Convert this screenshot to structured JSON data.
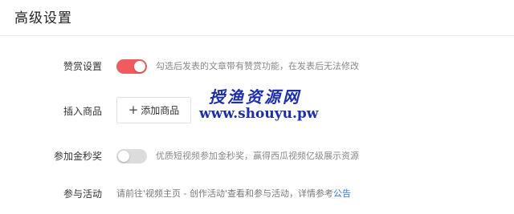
{
  "page": {
    "title": "高级设置"
  },
  "settings": {
    "appreciation": {
      "label": "赞赏设置",
      "toggle_on": true,
      "hint": "勾选后发表的文章带有赞赏功能，在发表后无法修改"
    },
    "insert_product": {
      "label": "插入商品",
      "button_label": "添加商品",
      "button_icon": "plus-icon"
    },
    "golden_second": {
      "label": "参加金秒奖",
      "toggle_on": false,
      "hint": "优质短视频参加金秒奖，赢得西瓜视频亿级展示资源"
    },
    "activity": {
      "label": "参与活动",
      "text": "请前往'视频主页 - 创作活动'查看和参与活动，详情参考",
      "link_label": "公告"
    }
  },
  "watermark": {
    "text_cn": "授渔资源网",
    "url": "www.shouyu.pw"
  },
  "colors": {
    "toggle_on": "#f05b5f",
    "toggle_off": "#dcdcdc",
    "link": "#3377dd",
    "watermark": "#1c2fa8"
  }
}
